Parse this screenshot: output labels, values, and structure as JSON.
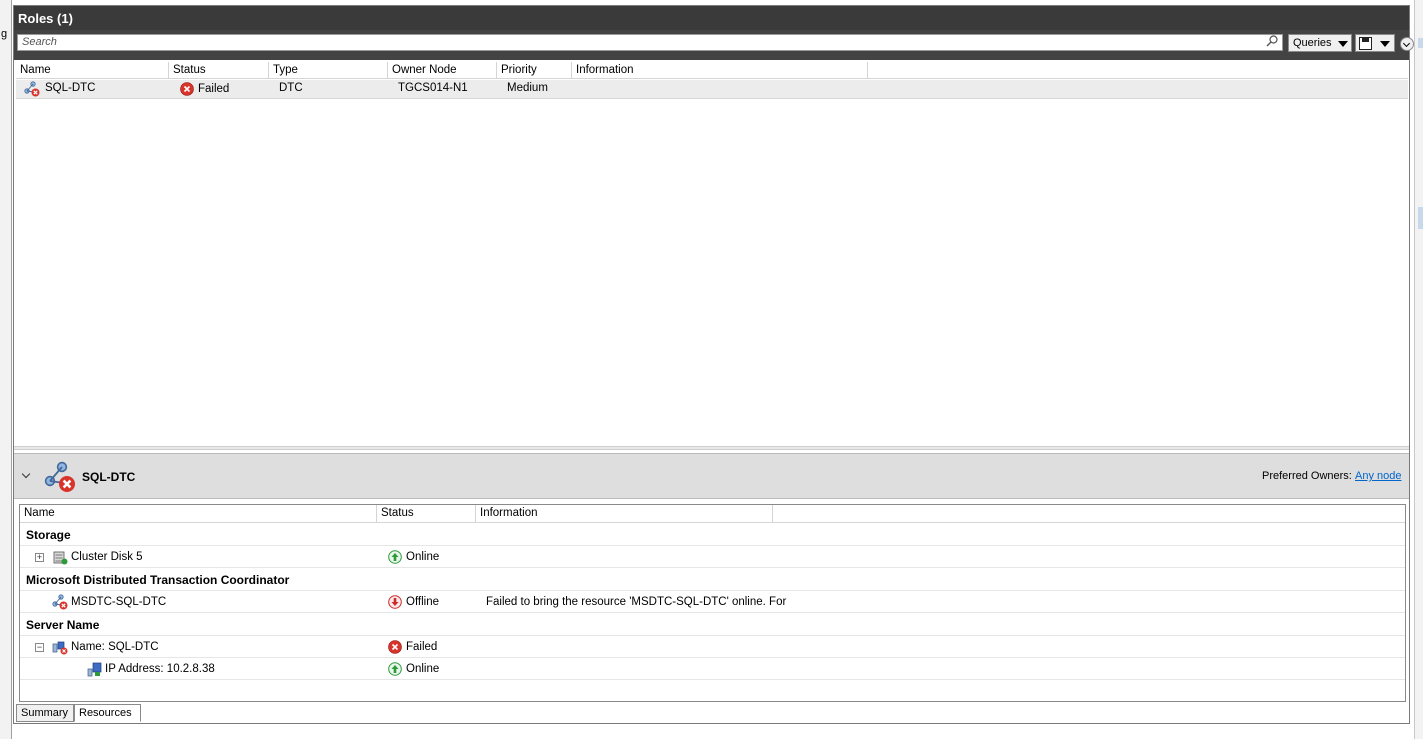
{
  "edges": {
    "left_char": "g"
  },
  "roles_panel": {
    "title": "Roles (1)",
    "search_placeholder": "Search",
    "queries_label": "Queries",
    "columns": [
      "Name",
      "Status",
      "Type",
      "Owner Node",
      "Priority",
      "Information"
    ],
    "rows": [
      {
        "name": "SQL-DTC",
        "status": "Failed",
        "type": "DTC",
        "owner_node": "TGCS014-N1",
        "priority": "Medium",
        "information": ""
      }
    ]
  },
  "detail": {
    "title": "SQL-DTC",
    "preferred_owners_label": "Preferred Owners:",
    "preferred_owners_value": "Any node",
    "columns": [
      "Name",
      "Status",
      "Information"
    ],
    "groups": [
      {
        "label": "Storage"
      },
      {
        "label": "Microsoft Distributed Transaction Coordinator"
      },
      {
        "label": "Server Name"
      }
    ],
    "resources": [
      {
        "name": "Cluster Disk 5",
        "status": "Online",
        "information": ""
      },
      {
        "name": "MSDTC-SQL-DTC",
        "status": "Offline",
        "information": "Failed to bring the resource 'MSDTC-SQL-DTC' online. For"
      },
      {
        "name": "Name: SQL-DTC",
        "status": "Failed",
        "information": ""
      },
      {
        "name": "IP Address: 10.2.8.38",
        "status": "Online",
        "information": ""
      }
    ]
  },
  "tabs": [
    "Summary",
    "Resources"
  ],
  "icons": {
    "role": "cluster-role-icon",
    "failed": "failed-status-icon",
    "online": "online-status-icon",
    "offline": "offline-status-icon",
    "disk": "cluster-disk-icon",
    "network_name": "network-name-icon",
    "ip": "ip-address-icon",
    "search": "search-icon"
  },
  "colors": {
    "title_bar": "#3a3a3a",
    "failed": "#d9342b",
    "online": "#2e9a3a",
    "offline": "#cc2b2b",
    "link": "#0066cc"
  }
}
